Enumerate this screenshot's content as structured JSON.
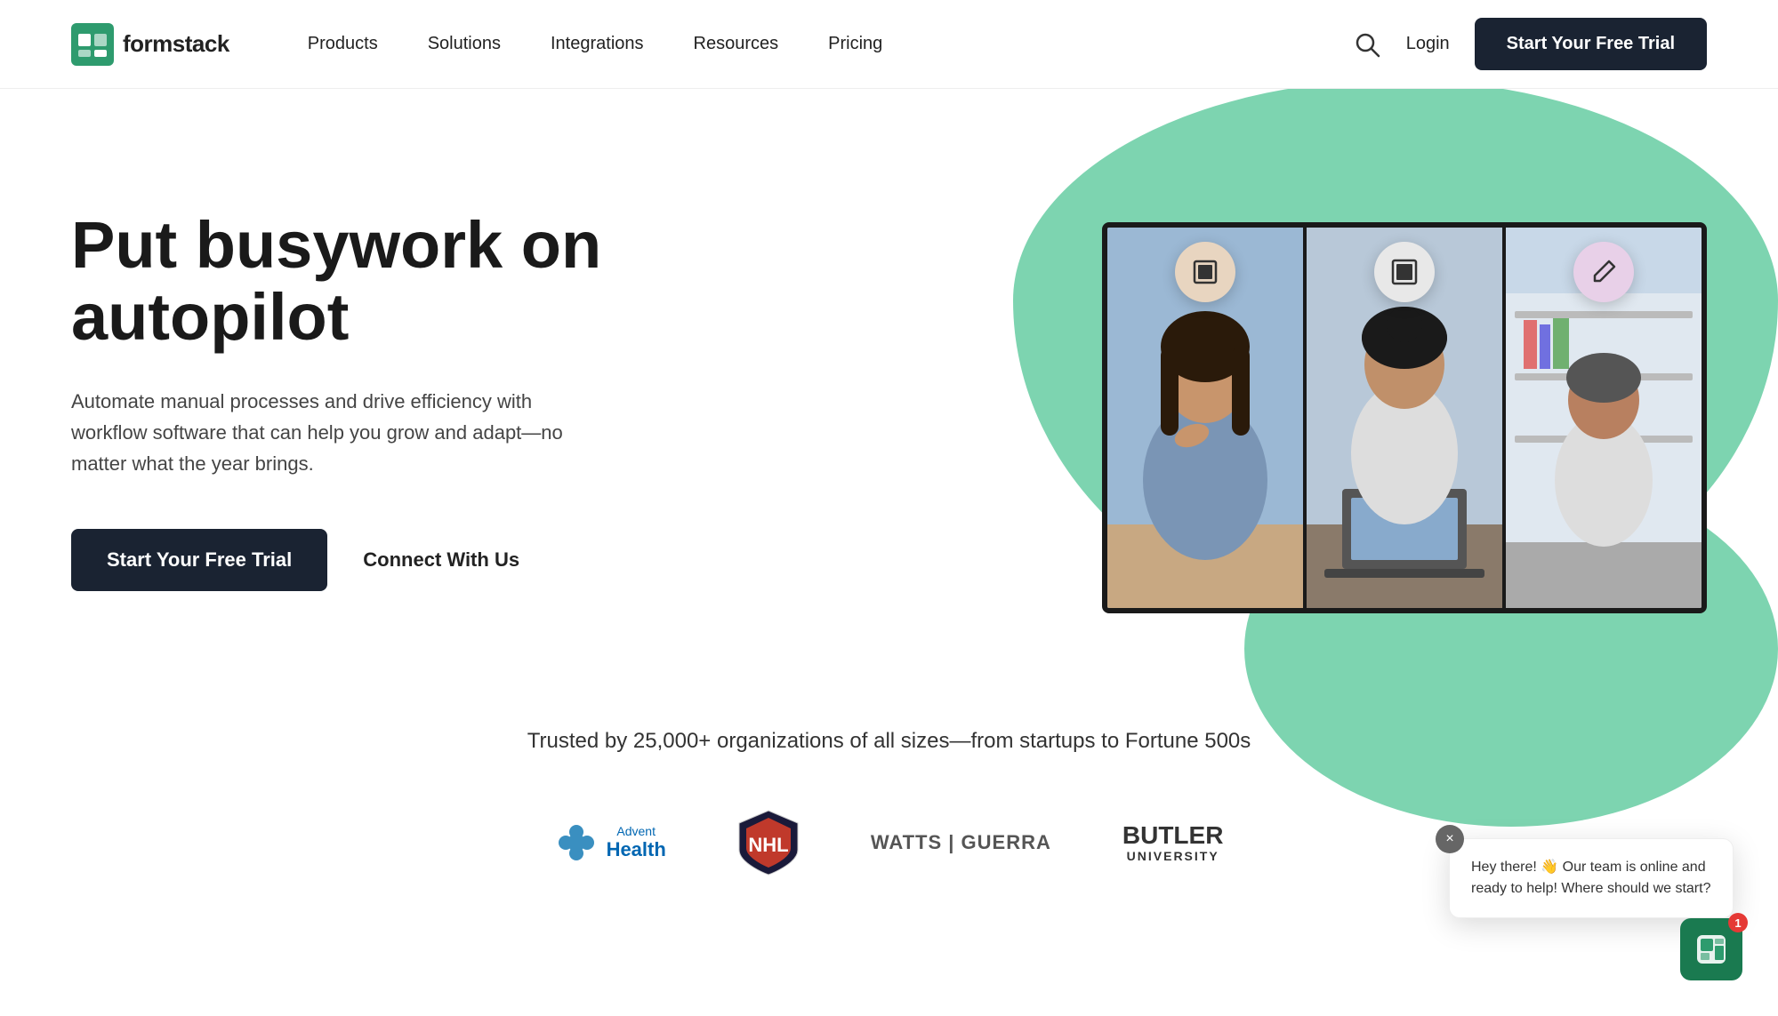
{
  "brand": {
    "name": "formstack",
    "logo_icon": "F"
  },
  "nav": {
    "links": [
      {
        "label": "Products",
        "id": "products"
      },
      {
        "label": "Solutions",
        "id": "solutions"
      },
      {
        "label": "Integrations",
        "id": "integrations"
      },
      {
        "label": "Resources",
        "id": "resources"
      },
      {
        "label": "Pricing",
        "id": "pricing"
      }
    ],
    "login_label": "Login",
    "cta_label": "Start Your Free Trial"
  },
  "hero": {
    "title": "Put busywork on autopilot",
    "subtitle": "Automate manual processes and drive efficiency with workflow software that can help you grow and adapt—no matter what the year brings.",
    "cta_primary": "Start Your Free Trial",
    "cta_secondary": "Connect With Us",
    "icons": {
      "badge1": "⬛",
      "badge2": "◼",
      "badge3": "✏️"
    }
  },
  "trusted": {
    "headline": "Trusted by 25,000+ organizations of all sizes—from startups to Fortune 500s",
    "logos": [
      {
        "name": "AdventHealth",
        "type": "advent"
      },
      {
        "name": "NHL",
        "type": "nhl"
      },
      {
        "name": "WATTS | GUERRA",
        "type": "watts"
      },
      {
        "name": "BUTLER UNIVERSITY",
        "type": "butler"
      }
    ]
  },
  "chat": {
    "message": "Hey there! 👋 Our team is online and ready to help! Where should we start?",
    "badge_count": "1",
    "close_icon": "×"
  },
  "colors": {
    "dark": "#1a2332",
    "green": "#7dd4b0",
    "green_dark": "#1a7a50",
    "accent_pink": "#e8d0e8",
    "accent_tan": "#e8d5c0"
  }
}
